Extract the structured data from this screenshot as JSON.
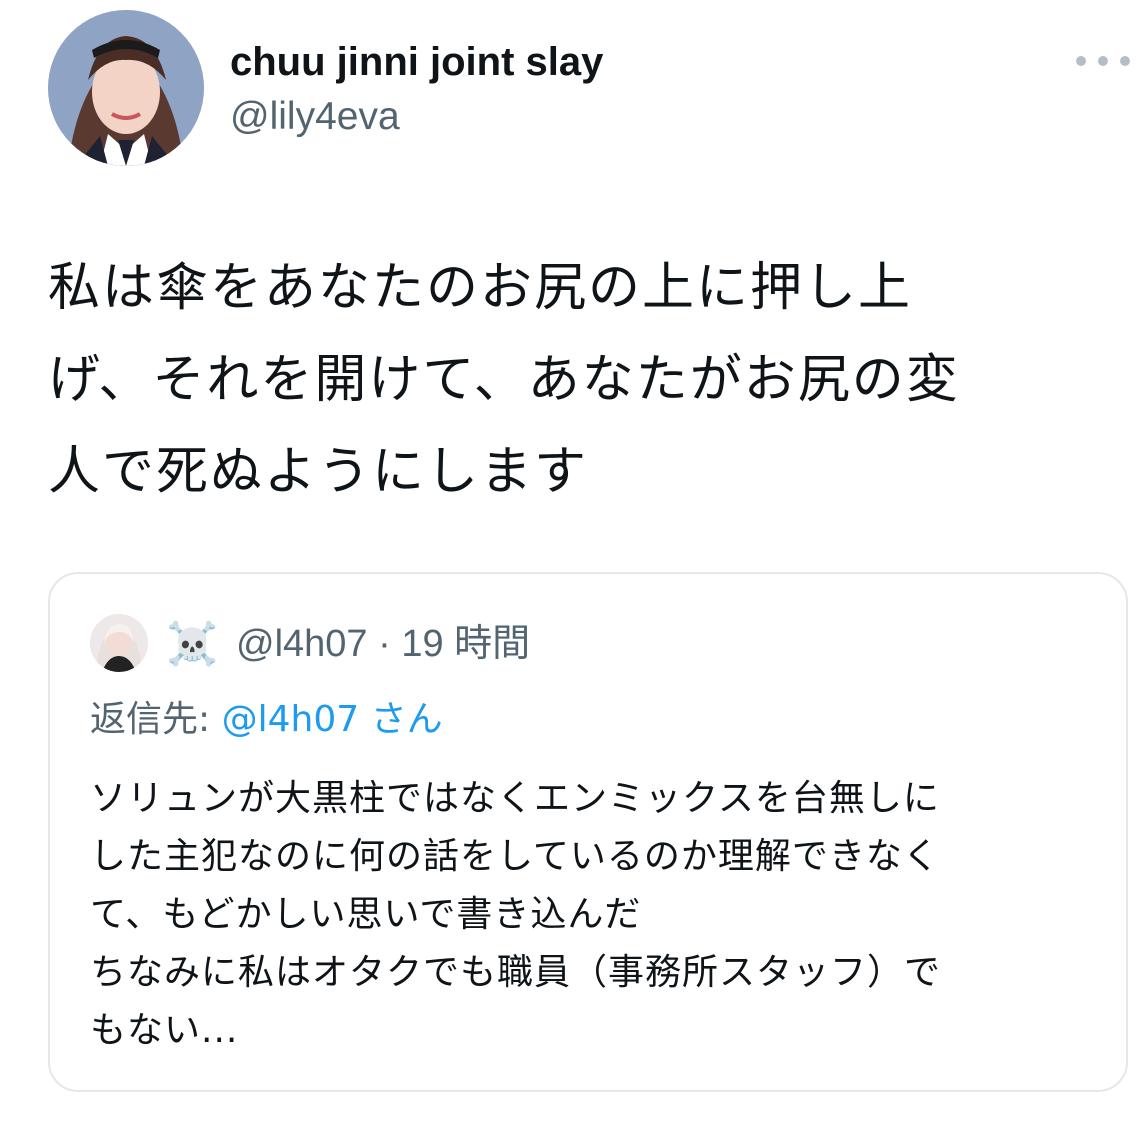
{
  "tweet": {
    "display_name": "chuu jinni joint slay",
    "handle": "@lily4eva",
    "avatar_icon": "profile-photo",
    "more_icon": "more-horizontal-icon",
    "text_lines": [
      "私は傘をあなたのお尻の上に押し上",
      "げ、それを開けて、あなたがお尻の変",
      "人で死ぬようにします"
    ]
  },
  "quoted_tweet": {
    "avatar_icon": "profile-photo",
    "name_emoji": "☠️",
    "handle": "@l4h07",
    "separator": "·",
    "time": "19 時間",
    "reply_prefix": "返信先:",
    "reply_mention": "@l4h07",
    "reply_suffix": "さん",
    "body_lines": [
      "ソリュンが大黒柱ではなくエンミックスを台無しに",
      "した主犯なのに何の話をしているのか理解できなく",
      "て、もどかしい思いで書き込んだ",
      "ちなみに私はオタクでも職員（事務所スタッフ）で",
      "もない..."
    ]
  },
  "colors": {
    "text_primary": "#0f1419",
    "text_secondary": "#536471",
    "link": "#1d9bf0",
    "border": "#e3e8ec",
    "more_dots": "#b5bec7"
  }
}
